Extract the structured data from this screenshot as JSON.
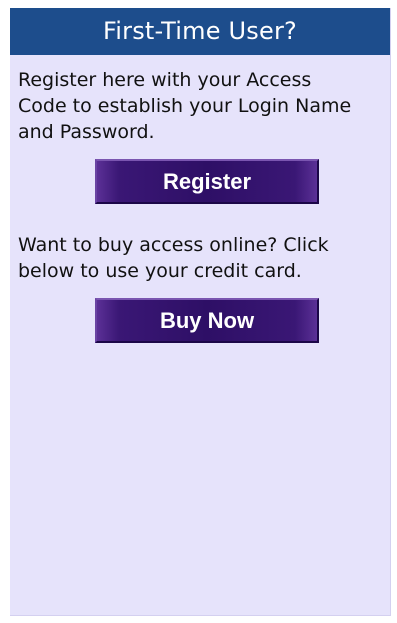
{
  "panel": {
    "title": "First-Time User?",
    "register_text": "Register here with your Access Code to establish your Login Name and Password.",
    "register_button": "Register",
    "buy_text": "Want to buy access online? Click below to use your credit card.",
    "buy_button": "Buy Now"
  },
  "colors": {
    "header_bg": "#1d4d8c",
    "panel_bg": "#e6e3fb",
    "button_bg": "#2e0f66"
  }
}
